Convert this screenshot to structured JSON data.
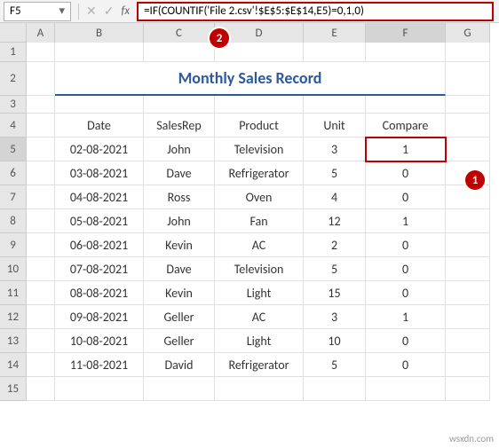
{
  "nameBox": "F5",
  "formula": "=IF(COUNTIF('File 2.csv'!$E$5:$E$14,E5)=0,1,0)",
  "columns": [
    "A",
    "B",
    "C",
    "D",
    "E",
    "F",
    "G"
  ],
  "rows": [
    "1",
    "2",
    "3",
    "4",
    "5",
    "6",
    "7",
    "8",
    "9",
    "10",
    "11",
    "12",
    "13",
    "14",
    "15"
  ],
  "title": "Monthly Sales Record",
  "headers": {
    "date": "Date",
    "salesrep": "SalesRep",
    "product": "Product",
    "unit": "Unit",
    "compare": "Compare"
  },
  "data": [
    {
      "date": "02-08-2021",
      "rep": "John",
      "product": "Television",
      "unit": "3",
      "compare": "1"
    },
    {
      "date": "03-08-2021",
      "rep": "Dave",
      "product": "Refrigerator",
      "unit": "5",
      "compare": "0"
    },
    {
      "date": "04-08-2021",
      "rep": "Ross",
      "product": "Oven",
      "unit": "4",
      "compare": "0"
    },
    {
      "date": "05-08-2021",
      "rep": "John",
      "product": "Fan",
      "unit": "12",
      "compare": "1"
    },
    {
      "date": "06-08-2021",
      "rep": "Kevin",
      "product": "AC",
      "unit": "2",
      "compare": "0"
    },
    {
      "date": "07-08-2021",
      "rep": "Dave",
      "product": "Television",
      "unit": "5",
      "compare": "0"
    },
    {
      "date": "08-08-2021",
      "rep": "Kevin",
      "product": "Light",
      "unit": "15",
      "compare": "0"
    },
    {
      "date": "09-08-2021",
      "rep": "Geller",
      "product": "AC",
      "unit": "3",
      "compare": "1"
    },
    {
      "date": "10-08-2021",
      "rep": "Geller",
      "product": "Light",
      "unit": "10",
      "compare": "0"
    },
    {
      "date": "11-08-2021",
      "rep": "David",
      "product": "Refrigerator",
      "unit": "5",
      "compare": "0"
    }
  ],
  "annotations": {
    "mark1": "1",
    "mark2": "2"
  },
  "watermark": "wsxdn.com",
  "activeCol": "F",
  "activeRow": "5"
}
